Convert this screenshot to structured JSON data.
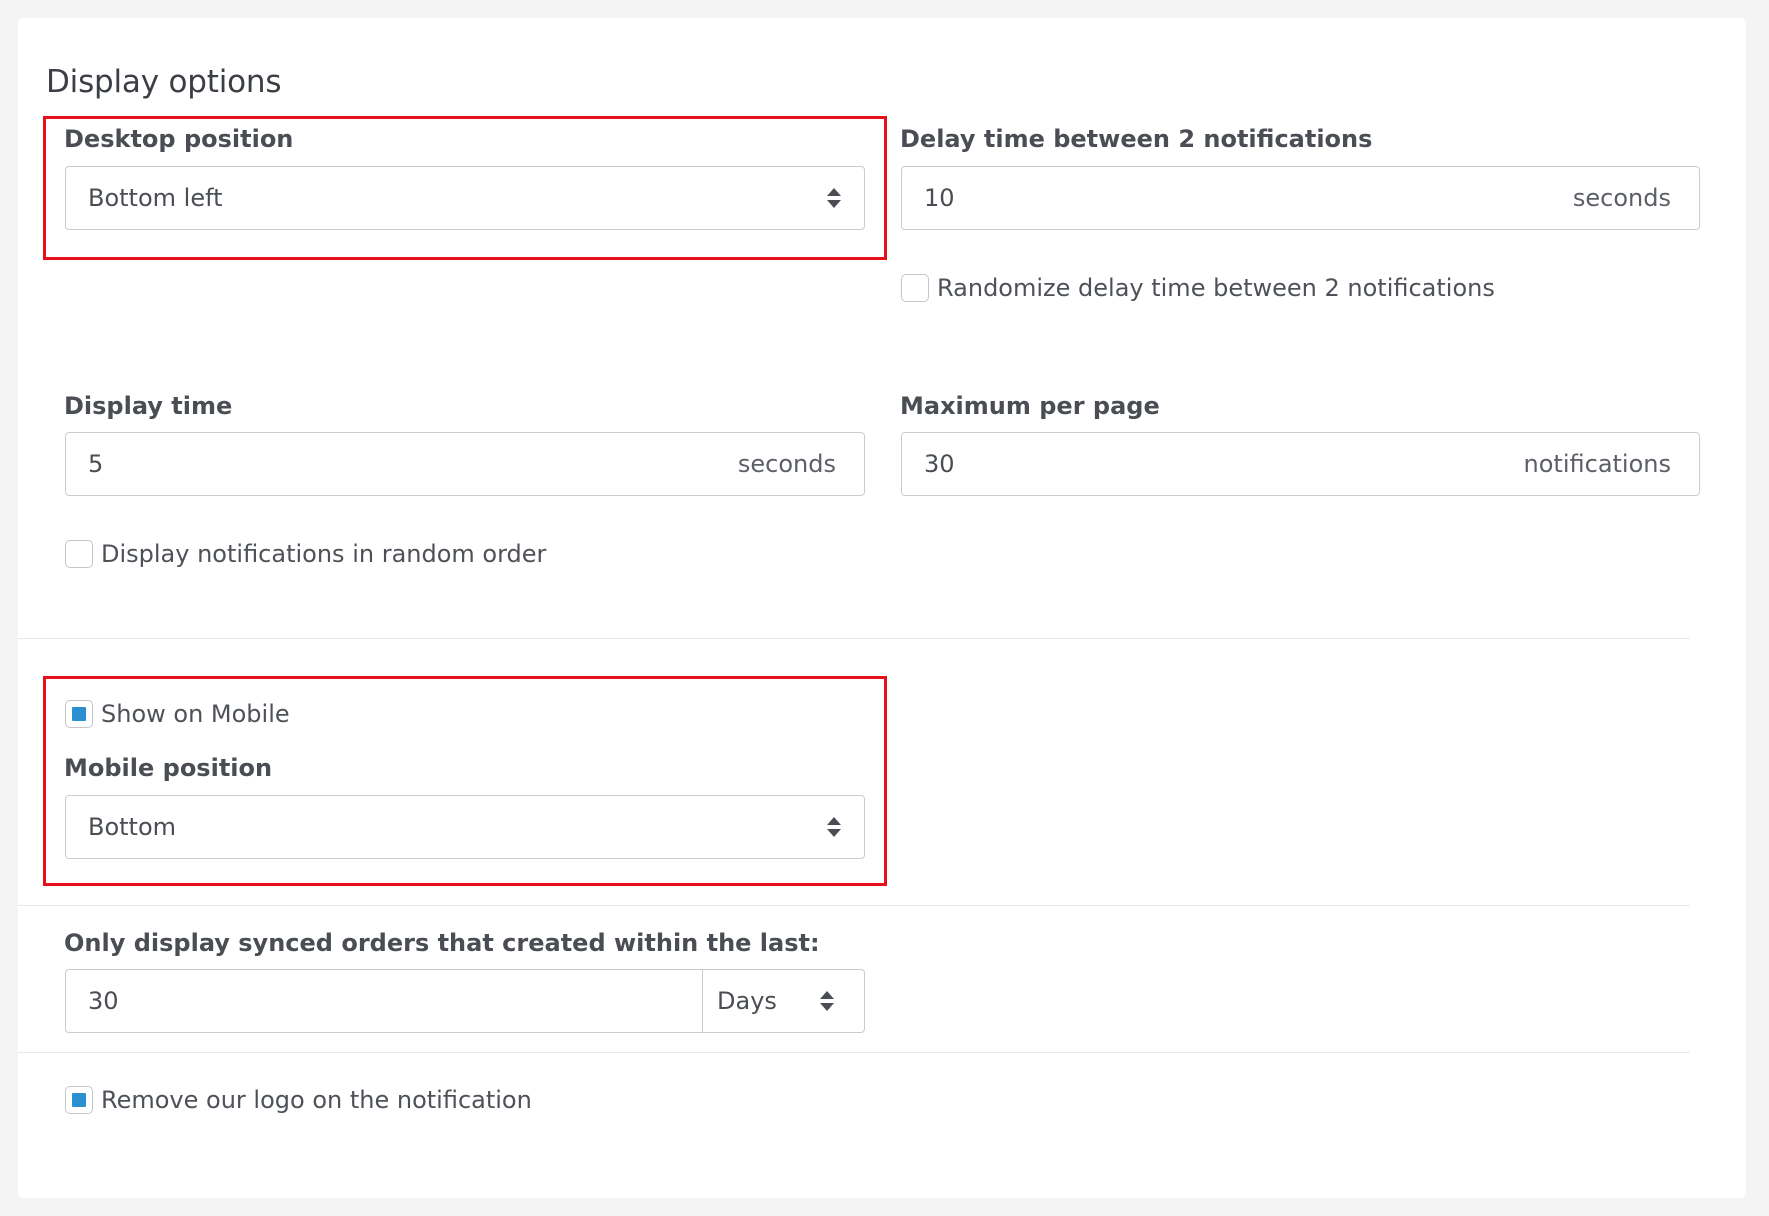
{
  "section": {
    "title": "Display options"
  },
  "desktop_position": {
    "label": "Desktop position",
    "selected": "Bottom left"
  },
  "delay_time": {
    "label": "Delay time between 2 notifications",
    "value": "10",
    "suffix": "seconds",
    "randomize_label": "Randomize delay time between 2 notifications",
    "randomize_checked": false
  },
  "display_time": {
    "label": "Display time",
    "value": "5",
    "suffix": "seconds"
  },
  "maximum_per_page": {
    "label": "Maximum per page",
    "value": "30",
    "suffix": "notifications"
  },
  "random_order": {
    "label": "Display notifications in random order",
    "checked": false
  },
  "mobile": {
    "show_label": "Show on Mobile",
    "show_checked": true,
    "position_label": "Mobile position",
    "position_selected": "Bottom"
  },
  "synced_orders": {
    "label": "Only display synced orders that created within the last:",
    "value": "30",
    "unit": "Days"
  },
  "remove_logo": {
    "label": "Remove our logo on the notification",
    "checked": true
  },
  "colors": {
    "highlight": "#e8101a",
    "checkbox_checked": "#2a8fd1"
  }
}
